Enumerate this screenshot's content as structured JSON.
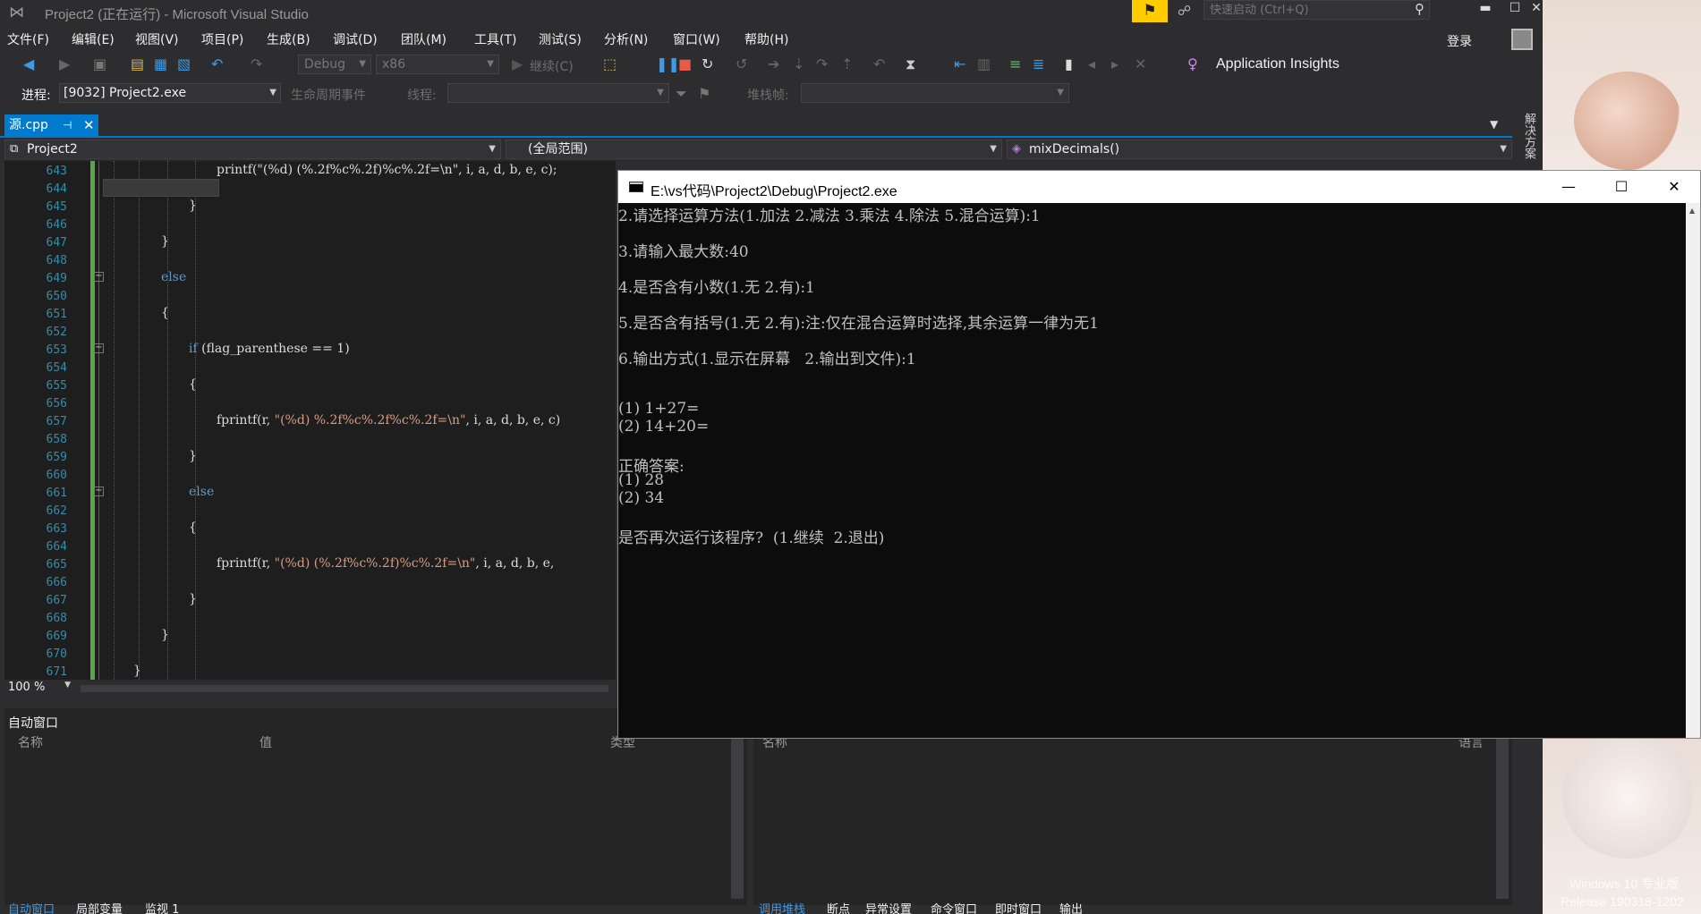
{
  "window": {
    "title": "Project2 (正在运行) - Microsoft Visual Studio",
    "quick_launch_placeholder": "快速启动 (Ctrl+Q)",
    "minimize": "▬",
    "maximize": "☐",
    "close": "✕"
  },
  "menu": [
    "文件(F)",
    "编辑(E)",
    "视图(V)",
    "项目(P)",
    "生成(B)",
    "调试(D)",
    "团队(M)",
    "工具(T)",
    "测试(S)",
    "分析(N)",
    "窗口(W)",
    "帮助(H)"
  ],
  "account": {
    "login": "登录"
  },
  "toolbar": {
    "config": "Debug",
    "platform": "x86",
    "continue": "继续(C)",
    "application_insights": "Application Insights",
    "process_label": "进程:",
    "process_value": "[9032] Project2.exe",
    "lifecycle": "生命周期事件",
    "thread_label": "线程:",
    "stack_label": "堆栈帧:"
  },
  "tabs": {
    "active_file": "源.cpp",
    "pin": "⊣",
    "close": "✕"
  },
  "navbar": {
    "project": "Project2",
    "scope": "(全局范围)",
    "member": "mixDecimals()"
  },
  "solution_explorer_tab": "解决方案",
  "editor": {
    "line_numbers": [
      "643",
      "644",
      "645",
      "646",
      "647",
      "648",
      "649",
      "650",
      "651",
      "652",
      "653",
      "654",
      "655",
      "656",
      "657",
      "658",
      "659",
      "660",
      "661",
      "662",
      "663",
      "664",
      "665",
      "666",
      "667",
      "668",
      "669",
      "670",
      "671"
    ],
    "lines": {
      "643": "printf(\"(%d) (%.2f%c%.2f)%c%.2f=\\n\", i, a, d, b, e, c);",
      "645": "}",
      "647": "}",
      "649": "else",
      "651": "{",
      "653_kw": "if",
      "653_rest": " (flag_parenthese == 1)",
      "655": "{",
      "657_fn": "fprintf(r, ",
      "657_str": "\"(%d) %.2f%c%.2f%c%.2f=\\n\"",
      "657_rest": ", i, a, d, b, e, c)",
      "659": "}",
      "661": "else",
      "663": "{",
      "665_fn": "fprintf(r, ",
      "665_str": "\"(%d) (%.2f%c%.2f)%c%.2f=\\n\"",
      "665_rest": ", i, a, d, b, e,",
      "667": "}",
      "669": "}",
      "671": "}"
    },
    "zoom": "100 %"
  },
  "autos": {
    "title": "自动窗口",
    "col_name": "名称",
    "col_value": "值",
    "col_type": "类型"
  },
  "callstack": {
    "col_name": "名称",
    "col_lang": "语言"
  },
  "bottom_tabs_left": [
    "自动窗口",
    "局部变量",
    "监视 1"
  ],
  "bottom_tabs_right": [
    "调用堆栈",
    "断点",
    "异常设置",
    "命令窗口",
    "即时窗口",
    "输出"
  ],
  "console": {
    "path": "E:\\vs代码\\Project2\\Debug\\Project2.exe",
    "minimize": "—",
    "maximize": "☐",
    "close": "✕",
    "lines": [
      "2.请选择运算方法(1.加法 2.减法 3.乘法 4.除法 5.混合运算):1",
      "",
      "3.请输入最大数:40",
      "",
      "4.是否含有小数(1.无 2.有):1",
      "",
      "5.是否含有括号(1.无 2.有):注:仅在混合运算时选择,其余运算一律为无1",
      "",
      "6.输出方式(1.显示在屏幕   2.输出到文件):1",
      "",
      "",
      "",
      "(1) 1+27=",
      "(2) 14+20=",
      "",
      "正确答案:",
      "(1) 28",
      "(2) 34",
      "",
      "是否再次运行该程序?  (1.继续  2.退出)"
    ]
  },
  "desktop_watermark": {
    "line1": "Windows 10 专业版",
    "line2": "Release 190318-1202"
  },
  "colors": {
    "vs_background": "#2d2d30",
    "editor_background": "#1e1e1e",
    "accent": "#007acc",
    "keyword": "#569cd6",
    "string": "#d69d85",
    "line_number": "#2b91af",
    "notification_flag": "#ffcc00",
    "console_background": "#0c0c0c"
  }
}
